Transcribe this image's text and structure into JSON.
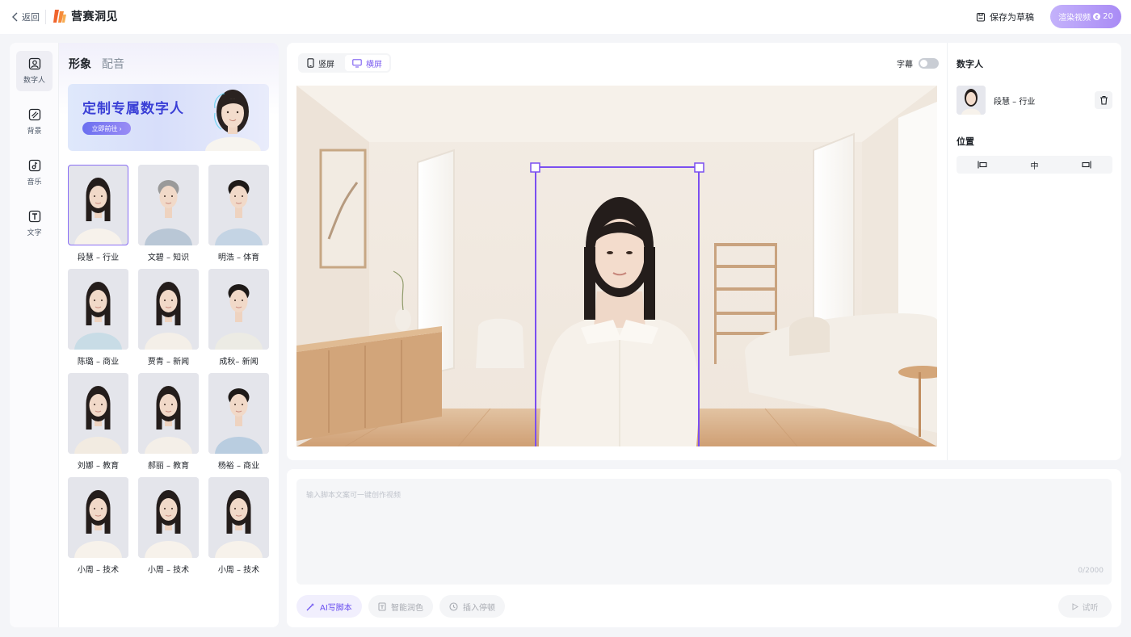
{
  "topbar": {
    "back_label": "返回",
    "brand": "营赛洞见",
    "save_draft": "保存为草稿",
    "render_label": "渲染视频",
    "render_cost": "20",
    "brand_color": "#f0642d",
    "accent_color": "#a98bf5"
  },
  "rail": {
    "items": [
      {
        "label": "数字人",
        "icon": "person-icon",
        "active": true
      },
      {
        "label": "背景",
        "icon": "background-icon",
        "active": false
      },
      {
        "label": "音乐",
        "icon": "music-icon",
        "active": false
      },
      {
        "label": "文字",
        "icon": "text-icon",
        "active": false
      }
    ]
  },
  "panel": {
    "tabs": [
      "形象",
      "配音"
    ],
    "banner_title": "定制专属数字人",
    "banner_button": "立即前往",
    "avatars": [
      {
        "name": "段慧 – 行业",
        "selected": true
      },
      {
        "name": "文碧 – 知识"
      },
      {
        "name": "明浩 – 体育"
      },
      {
        "name": "陈璐 – 商业"
      },
      {
        "name": "贾青 – 新闻"
      },
      {
        "name": "成秋– 新闻"
      },
      {
        "name": "刘娜 – 教育"
      },
      {
        "name": "郝丽 – 教育"
      },
      {
        "name": "杨裕 – 商业"
      },
      {
        "name": "小周 – 技术"
      },
      {
        "name": "小周 – 技术"
      },
      {
        "name": "小周 – 技术"
      }
    ]
  },
  "preview": {
    "orientation": {
      "portrait": "竖屏",
      "landscape": "横屏",
      "active": "landscape"
    },
    "subtitle_label": "字幕",
    "subtitle_on": false,
    "accent_color": "#7b5cf0"
  },
  "side": {
    "section_avatar": "数字人",
    "current_avatar": "段慧 – 行业",
    "section_position": "位置",
    "align_labels": [
      "",
      "中",
      ""
    ]
  },
  "script": {
    "placeholder": "输入脚本文案可一键创作视频",
    "counter": "0/2000",
    "ai_button": "AI写脚本",
    "polish_button": "智能润色",
    "pause_button": "插入停顿",
    "trial_button": "试听"
  }
}
